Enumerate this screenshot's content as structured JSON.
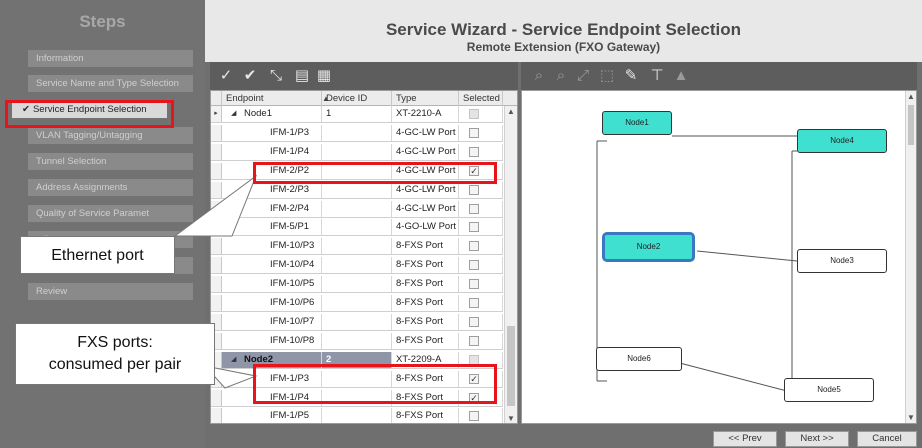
{
  "steps": {
    "title": "Steps",
    "items": [
      {
        "label": "Information",
        "state": "disabled"
      },
      {
        "label": "Service Name and Type Selection",
        "state": "disabled"
      },
      {
        "label": "Service Endpoint Selection",
        "state": "active"
      },
      {
        "label": "VLAN Tagging/Untagging",
        "state": "disabled"
      },
      {
        "label": "Tunnel Selection",
        "state": "disabled"
      },
      {
        "label": "Address Assignments",
        "state": "disabled"
      },
      {
        "label": "Quality of Service Paramet",
        "state": "disabled"
      },
      {
        "label": "tail",
        "state": "disabled"
      },
      {
        "label": "",
        "state": "disabled"
      },
      {
        "label": "Review",
        "state": "disabled"
      }
    ],
    "active_check": "✔"
  },
  "header": {
    "title": "Service Wizard - Service Endpoint Selection",
    "subtitle": "Remote Extension (FXO Gateway)"
  },
  "table": {
    "columns": [
      "Endpoint",
      "Device ID",
      "Type",
      "Selected"
    ],
    "rows": [
      {
        "endpoint": "Node1",
        "device_id": "1",
        "type": "XT-2210-A",
        "selected": false,
        "kind": "node"
      },
      {
        "endpoint": "IFM-1/P3",
        "device_id": "",
        "type": "4-GC-LW Port",
        "selected": false,
        "kind": "port"
      },
      {
        "endpoint": "IFM-1/P4",
        "device_id": "",
        "type": "4-GC-LW Port",
        "selected": false,
        "kind": "port"
      },
      {
        "endpoint": "IFM-2/P2",
        "device_id": "",
        "type": "4-GC-LW Port",
        "selected": true,
        "kind": "port"
      },
      {
        "endpoint": "IFM-2/P3",
        "device_id": "",
        "type": "4-GC-LW Port",
        "selected": false,
        "kind": "port"
      },
      {
        "endpoint": "IFM-2/P4",
        "device_id": "",
        "type": "4-GC-LW Port",
        "selected": false,
        "kind": "port"
      },
      {
        "endpoint": "IFM-5/P1",
        "device_id": "",
        "type": "4-GO-LW Port",
        "selected": false,
        "kind": "port"
      },
      {
        "endpoint": "IFM-10/P3",
        "device_id": "",
        "type": "8-FXS Port",
        "selected": false,
        "kind": "port"
      },
      {
        "endpoint": "IFM-10/P4",
        "device_id": "",
        "type": "8-FXS Port",
        "selected": false,
        "kind": "port"
      },
      {
        "endpoint": "IFM-10/P5",
        "device_id": "",
        "type": "8-FXS Port",
        "selected": false,
        "kind": "port"
      },
      {
        "endpoint": "IFM-10/P6",
        "device_id": "",
        "type": "8-FXS Port",
        "selected": false,
        "kind": "port"
      },
      {
        "endpoint": "IFM-10/P7",
        "device_id": "",
        "type": "8-FXS Port",
        "selected": false,
        "kind": "port"
      },
      {
        "endpoint": "IFM-10/P8",
        "device_id": "",
        "type": "8-FXS Port",
        "selected": false,
        "kind": "port"
      },
      {
        "endpoint": "Node2",
        "device_id": "2",
        "type": "XT-2209-A",
        "selected": false,
        "kind": "node"
      },
      {
        "endpoint": "IFM-1/P3",
        "device_id": "",
        "type": "8-FXS Port",
        "selected": true,
        "kind": "port"
      },
      {
        "endpoint": "IFM-1/P4",
        "device_id": "",
        "type": "8-FXS Port",
        "selected": true,
        "kind": "port"
      },
      {
        "endpoint": "IFM-1/P5",
        "device_id": "",
        "type": "8-FXS Port",
        "selected": false,
        "kind": "port"
      }
    ]
  },
  "topology": {
    "nodes": [
      "Node1",
      "Node4",
      "Node2",
      "Node3",
      "Node6",
      "Node5"
    ],
    "highlighted": "Node2"
  },
  "footer": {
    "prev": "<< Prev",
    "next": "Next >>",
    "cancel": "Cancel"
  },
  "annotations": {
    "ethernet": "Ethernet port",
    "fxs_line1": "FXS ports:",
    "fxs_line2": "consumed per pair"
  },
  "colors": {
    "highlight_red": "#e8141c",
    "node_teal": "#40e0d0",
    "node_selected_border": "#3b78c4"
  }
}
